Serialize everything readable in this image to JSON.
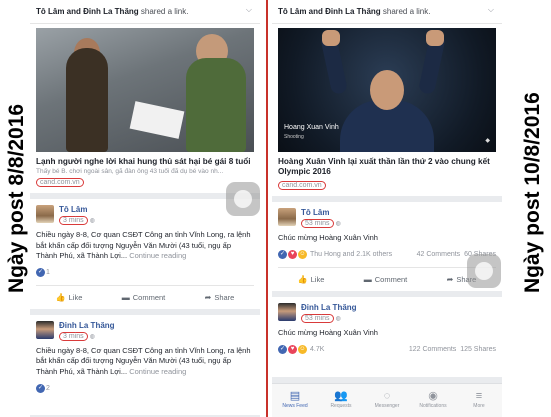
{
  "left": {
    "side_label": "Ngày post  8/8/2016",
    "share_header": {
      "names": "Tô Lâm and Đinh La Thăng",
      "suffix": " shared a link."
    },
    "link": {
      "title": "Lạnh người nghe lời khai hung thủ sát hại bé gái 8 tuổi",
      "desc": "Thấy bé B. chơi ngoài sân, gã đàn ông 43 tuổi đã dụ bé vào nh...",
      "domain": "cand.com.vn"
    },
    "post1": {
      "author": "Tô Lâm",
      "time": "3 mins",
      "text": "Chiều ngày 8-8, Cơ quan CSĐT Công an tỉnh Vĩnh Long, ra lệnh bắt khẩn cấp đối tượng Nguyễn Văn Mười (43 tuổi, ngụ ấp Thành Phú, xã Thành Lợi...",
      "more": "Continue reading",
      "reaction_count": "1",
      "actions": [
        "Like",
        "Comment",
        "Share"
      ]
    },
    "post2": {
      "author": "Đinh La Thăng",
      "time": "3 mins",
      "text": "Chiều ngày 8-8, Cơ quan CSĐT Công an tỉnh Vĩnh Long, ra lệnh bắt khẩn cấp đối tượng Nguyễn Văn Mười (43 tuổi, ngụ ấp Thành Phú, xã Thành Lợi...",
      "more": "Continue reading",
      "reaction_count": "2"
    }
  },
  "right": {
    "side_label": "Ngày post  10/8/2016",
    "share_header": {
      "names": "Tô Lâm and Đinh La Thăng",
      "suffix": " shared a link."
    },
    "photo_caption": {
      "name": "Hoang Xuan Vinh",
      "sub": "Shooting"
    },
    "link": {
      "title": "Hoàng Xuân Vinh lại xuất thần lần thứ 2 vào chung kết Olympic 2016",
      "domain": "cand.com.vn"
    },
    "post1": {
      "author": "Tô Lâm",
      "time": "53 mins",
      "text": "Chúc mừng Hoàng Xuân Vinh",
      "reactions": "Thu Hong and 2.1K others",
      "comments": "42 Comments",
      "shares": "60 Shares",
      "actions": [
        "Like",
        "Comment",
        "Share"
      ]
    },
    "post2": {
      "author": "Đinh La Thăng",
      "time": "53 mins",
      "text": "Chúc mừng Hoàng Xuân Vinh",
      "reactions": "4.7K",
      "comments": "122 Comments",
      "shares": "125 Shares"
    },
    "tabbar": [
      "News Feed",
      "Requests",
      "Messenger",
      "Notifications",
      "More"
    ]
  },
  "icons": [
    "like-icon",
    "comment-icon",
    "share-icon",
    "globe-icon",
    "newsfeed-icon",
    "requests-icon",
    "messenger-icon",
    "notifications-icon",
    "more-icon"
  ],
  "colors": {
    "highlight_circle": "#d93a3a",
    "divider": "#c8312a",
    "link_blue": "#365899",
    "fb_blue": "#4267b2"
  }
}
